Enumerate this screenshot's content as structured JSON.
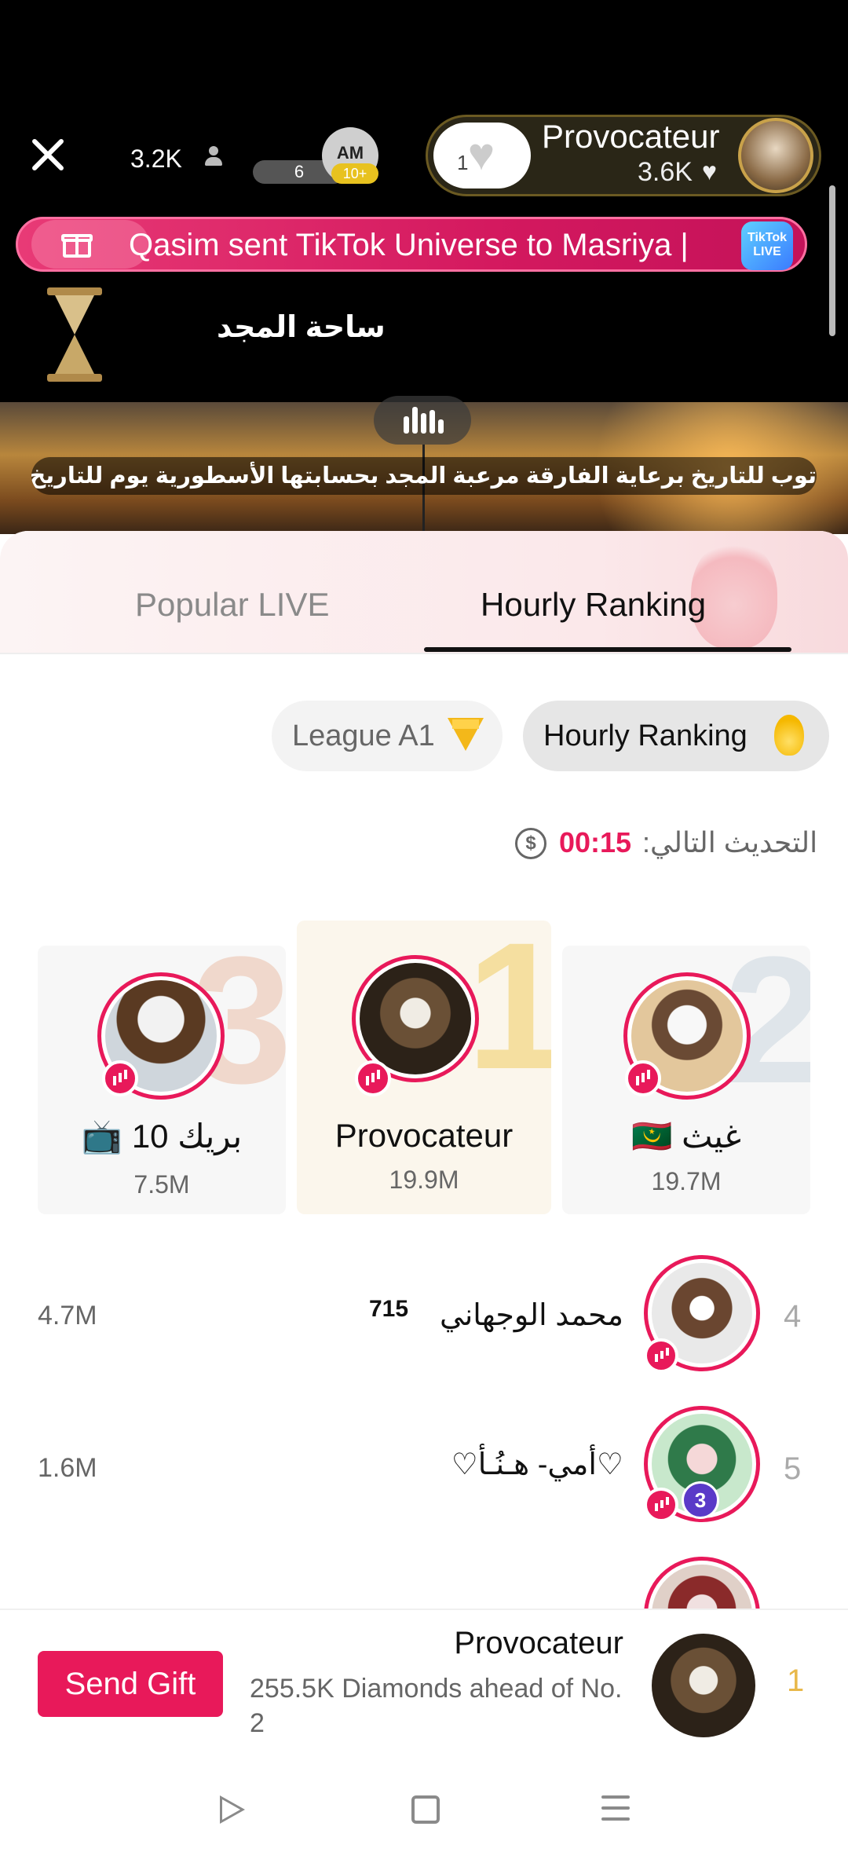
{
  "stream": {
    "viewer_count": "3.2K",
    "level_pill": "6",
    "mini_avatar_text": "AM",
    "mini_badge": "10+",
    "host_heart_count": "1",
    "host_name": "Provocateur",
    "host_likes": "3.6K",
    "gift_banner": "Qasim sent TikTok Universe to Masriya |",
    "tiktok_live_label": "TikTok LIVE",
    "room_title": "ساحة المجد",
    "video_caption": "توب للتاريخ برعاية الفارقة مرعبة المجد بحسابتها الأسطورية يوم للتاريخ بمعني الكلمة"
  },
  "tabs": {
    "popular": "Popular LIVE",
    "hourly": "Hourly Ranking"
  },
  "chips": {
    "league": "League A1",
    "hourly": "Hourly Ranking"
  },
  "refresh": {
    "label": "التحديث التالي:",
    "timer": "00:15",
    "icon_text": "$"
  },
  "podium": [
    {
      "rank": "3",
      "name": "بريك 10 📺",
      "score": "7.5M"
    },
    {
      "rank": "1",
      "name": "Provocateur",
      "score": "19.9M"
    },
    {
      "rank": "2",
      "name": "غيث 🇲🇷",
      "score": "19.7M"
    }
  ],
  "list": [
    {
      "rank": "4",
      "name": "محمد الوجهاني",
      "num": "715",
      "score": "4.7M"
    },
    {
      "rank": "5",
      "name": "♡أمي- هـنُـأ♡",
      "level": "3",
      "score": "1.6M"
    }
  ],
  "me": {
    "rank": "1",
    "name": "Provocateur",
    "diff": "255.5K Diamonds ahead of No. 2",
    "send_gift": "Send Gift"
  },
  "colors": {
    "accent": "#e8195a",
    "gold": "#e8b84a"
  }
}
